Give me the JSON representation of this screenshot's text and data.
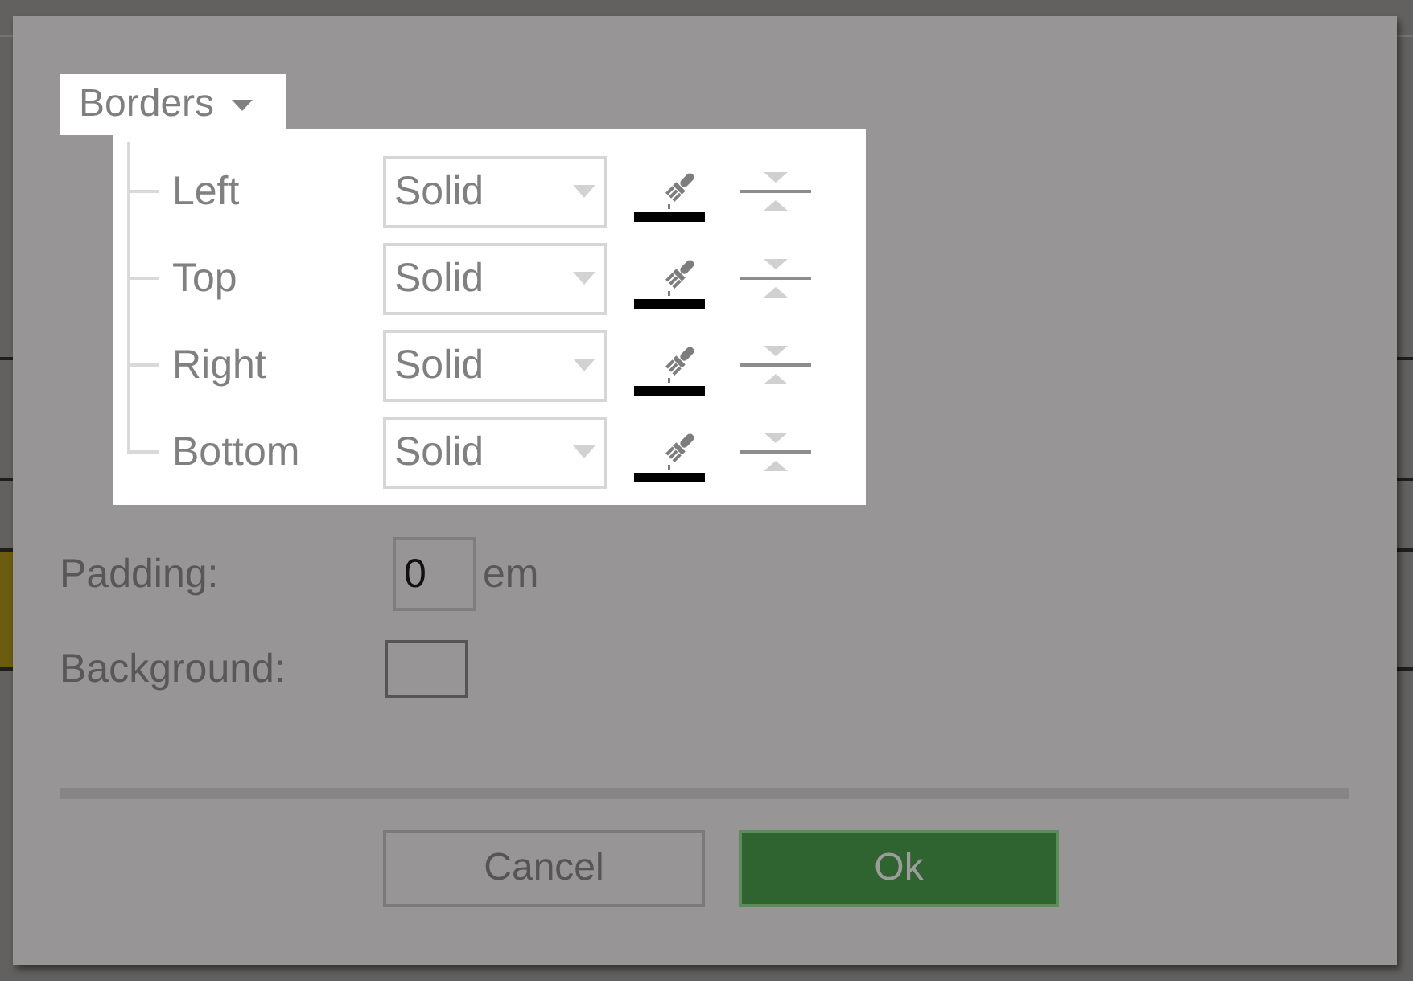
{
  "borders": {
    "title": "Borders",
    "expanded": true,
    "sides": [
      {
        "label": "Left",
        "style": "Solid",
        "color": "#000000"
      },
      {
        "label": "Top",
        "style": "Solid",
        "color": "#000000"
      },
      {
        "label": "Right",
        "style": "Solid",
        "color": "#000000"
      },
      {
        "label": "Bottom",
        "style": "Solid",
        "color": "#000000"
      }
    ]
  },
  "padding": {
    "label": "Padding:",
    "value": "0",
    "unit": "em"
  },
  "background": {
    "label": "Background:"
  },
  "buttons": [
    {
      "label": "Cancel",
      "kind": "secondary"
    },
    {
      "label": "Ok",
      "kind": "primary"
    }
  ]
}
